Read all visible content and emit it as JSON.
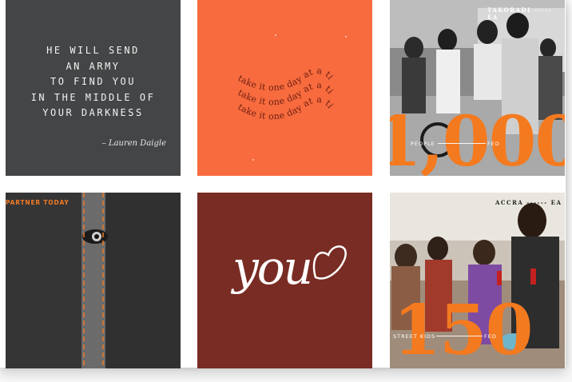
{
  "tiles": {
    "quote": {
      "text": "HE WILL SEND\nAN ARMY\nTO FIND YOU\nIN THE MIDDLE OF\nYOUR DARKNESS",
      "author": "– Lauren Daigle"
    },
    "wave": {
      "line": "take it one day at a time"
    },
    "takoradi": {
      "location": "TAKORADI ----- EA",
      "number": "1,000",
      "label_left": "PEOPLE",
      "label_right": "FED"
    },
    "partner": {
      "text": "PARTNER TODAY"
    },
    "you": {
      "word": "you"
    },
    "accra": {
      "location": "ACCRA ------ EA",
      "number": "150",
      "label_left": "STREET KIDS",
      "label_right": "FED"
    }
  },
  "colors": {
    "orange": "#f86b3e",
    "accent_orange": "#f47a1f",
    "charcoal": "#444546",
    "maroon": "#792c23"
  }
}
